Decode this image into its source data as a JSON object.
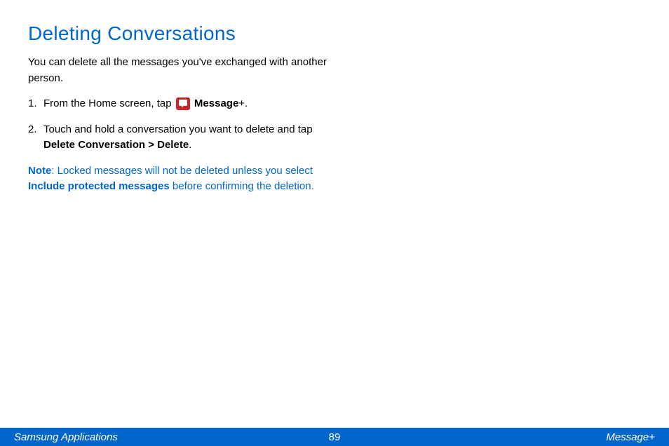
{
  "heading": "Deleting Conversations",
  "intro": "You can delete all the messages you've exchanged with another person.",
  "steps": {
    "step1_prefix": "From the Home screen, tap ",
    "step1_app_bold": "Message",
    "step1_app_suffix": "+.",
    "step2_prefix": "Touch and hold a conversation you want to delete and tap ",
    "step2_bold": "Delete Conversation > Delete",
    "step2_suffix": "."
  },
  "note": {
    "label": "Note",
    "text_prefix": ": Locked messages will not be deleted unless you select ",
    "bold_text": "Include protected messages",
    "text_suffix": " before confirming the deletion."
  },
  "footer": {
    "left": "Samsung Applications",
    "center": "89",
    "right": "Message+"
  }
}
